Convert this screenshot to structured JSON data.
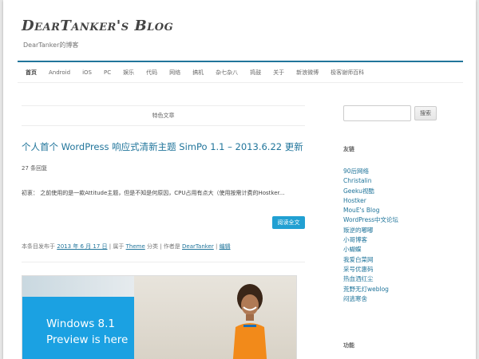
{
  "site": {
    "title": "DearTanker's Blog",
    "description": "DearTanker的博客"
  },
  "nav": [
    "首页",
    "Android",
    "iOS",
    "PC",
    "娱乐",
    "代码",
    "网络",
    "搞机",
    "杂七杂八",
    "捣鼓",
    "关于",
    "新浪微博",
    "极客谢师百科"
  ],
  "main": {
    "featured_label": "特色文章",
    "post_title": "个人首个 WordPress 响应式清新主题 SimPo 1.1 – 2013.6.22 更新",
    "comments": "27 条回复",
    "excerpt": "初衷： 之前使用的是一款Attitude主题，但是不知是何原因，CPU占用有点大（使用按需计费的Hostker...",
    "read_more": "阅读全文",
    "meta": {
      "prefix": "本条目发布于",
      "date": "2013 年 6 月 17 日",
      "sep1": "| 属于",
      "category": "Theme",
      "sep2": "分类 | 作者是",
      "author": "DearTanker",
      "sep3": "|",
      "edit": "编辑"
    },
    "image_text_line1": "Windows 8.1",
    "image_text_line2": "Preview is here"
  },
  "sidebar": {
    "search_placeholder": "",
    "search_button": "搜索",
    "links_title": "友链",
    "links": [
      "90后网络",
      "Christalin",
      "Geeku视酷",
      "Hostker",
      "MouE's Blog",
      "WordPress中文论坛",
      "叛逆的嘟嘟",
      "小哥博客",
      "小蝴蝶",
      "我爱白菜网",
      "采号优惠码",
      "热血洒红尘",
      "荒野无灯weblog",
      "闷逃寒舍"
    ],
    "functions_title": "功能"
  },
  "colors": {
    "accent": "#21759b",
    "button_blue": "#21a0d2",
    "windows_blue": "#1ba1e2"
  }
}
